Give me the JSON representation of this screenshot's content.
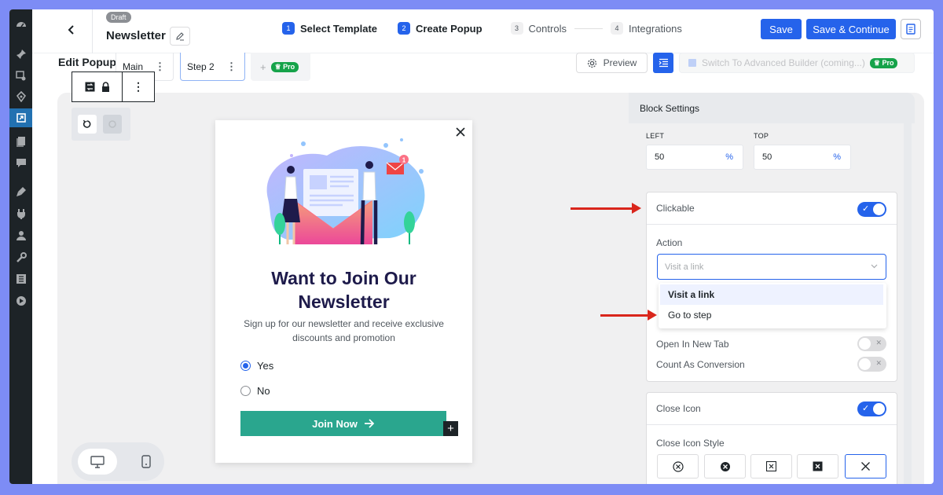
{
  "header": {
    "draft_badge": "Draft",
    "title": "Newsletter",
    "steps": [
      {
        "num": "1",
        "label": "Select Template"
      },
      {
        "num": "2",
        "label": "Create Popup"
      },
      {
        "num": "3",
        "label": "Controls"
      },
      {
        "num": "4",
        "label": "Integrations"
      }
    ],
    "save_label": "Save",
    "save_continue_label": "Save & Continue"
  },
  "editor": {
    "edit_popup_label": "Edit Popup",
    "tabs": [
      {
        "label": "Main"
      },
      {
        "label": "Step 2"
      }
    ],
    "add_tab_plus": "+",
    "pro_label": "Pro",
    "preview_label": "Preview",
    "advanced_builder_label": "Switch To Advanced Builder (coming...)"
  },
  "popup": {
    "heading_line1": "Want to Join Our",
    "heading_line2": "Newsletter",
    "subtext": "Sign up for our newsletter and receive exclusive discounts and promotion",
    "options": [
      "Yes",
      "No"
    ],
    "selected_option": "Yes",
    "button_label": "Join Now",
    "notification_count": "1"
  },
  "panel": {
    "title": "Block Settings",
    "left_label": "LEFT",
    "left_value": "50",
    "top_label": "TOP",
    "top_value": "50",
    "unit": "%",
    "clickable_label": "Clickable",
    "action_label": "Action",
    "action_placeholder": "Visit a link",
    "action_options": [
      "Visit a link",
      "Go to step"
    ],
    "open_new_tab_label": "Open In New Tab",
    "count_conversion_label": "Count As Conversion",
    "close_icon_label": "Close Icon",
    "close_icon_style_label": "Close Icon Style"
  },
  "colors": {
    "accent": "#2563eb",
    "button": "#2aa68e",
    "heading": "#1e1b4b",
    "annotation_arrow": "#d9261c"
  }
}
